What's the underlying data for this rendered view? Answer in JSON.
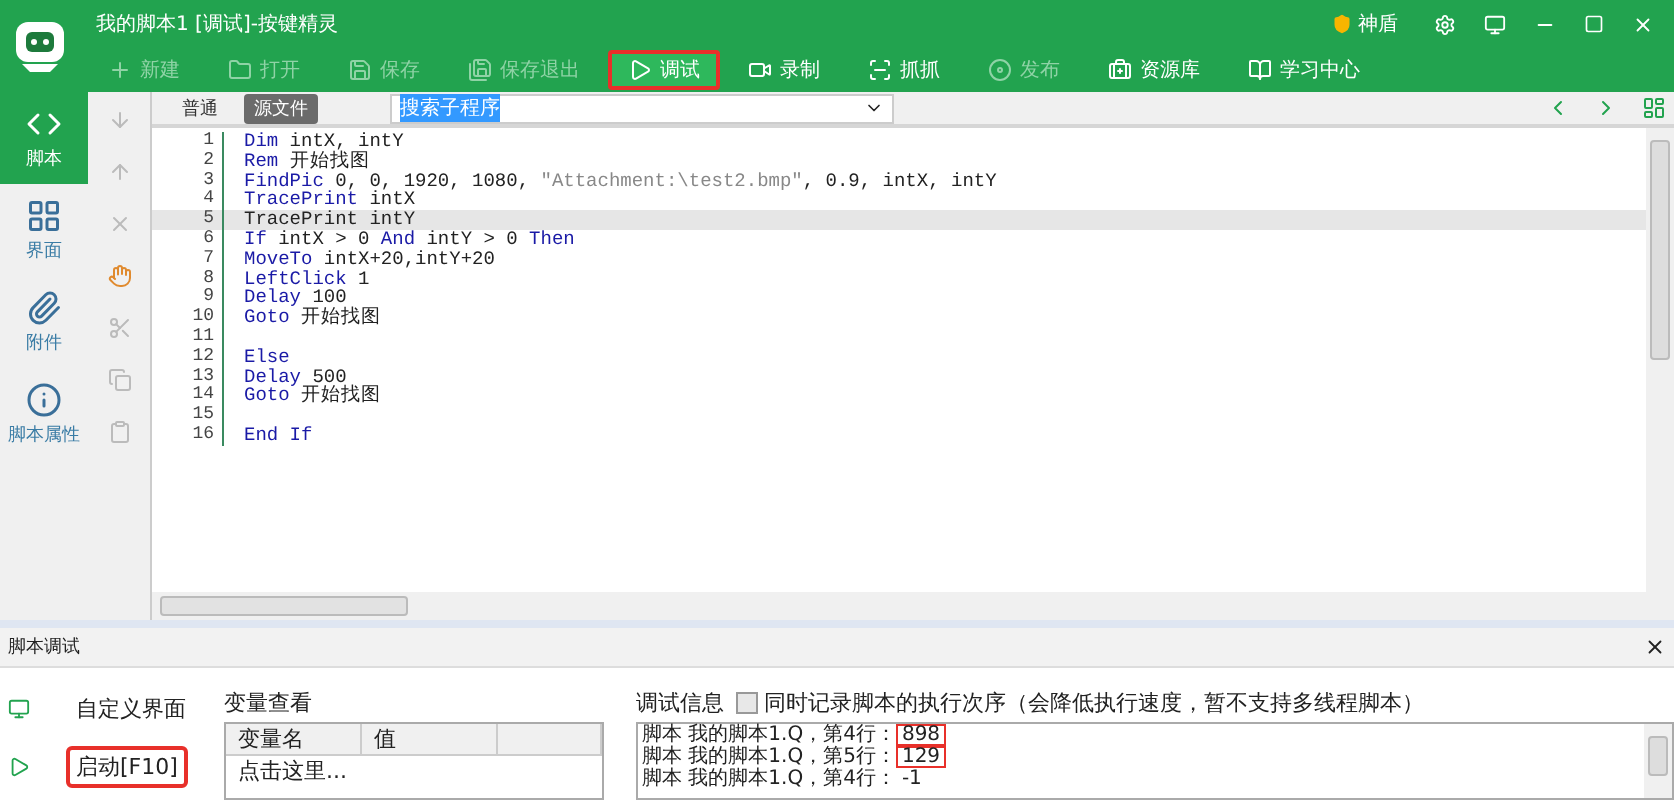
{
  "window": {
    "title": "我的脚本1 [调试]-按键精灵",
    "shield": "神盾"
  },
  "toolbar": [
    {
      "label": "新建",
      "disabled": true,
      "selected": false,
      "highlighted": false
    },
    {
      "label": "打开",
      "disabled": true,
      "selected": false,
      "highlighted": false
    },
    {
      "label": "保存",
      "disabled": true,
      "selected": false,
      "highlighted": false
    },
    {
      "label": "保存退出",
      "disabled": true,
      "selected": false,
      "highlighted": false
    },
    {
      "label": "调试",
      "disabled": false,
      "selected": true,
      "highlighted": true
    },
    {
      "label": "录制",
      "disabled": false,
      "selected": false,
      "highlighted": false
    },
    {
      "label": "抓抓",
      "disabled": false,
      "selected": false,
      "highlighted": false
    },
    {
      "label": "发布",
      "disabled": true,
      "selected": false,
      "highlighted": false
    },
    {
      "label": "资源库",
      "disabled": false,
      "selected": false,
      "highlighted": false
    },
    {
      "label": "学习中心",
      "disabled": false,
      "selected": false,
      "highlighted": false
    }
  ],
  "sidebar": {
    "items": [
      {
        "label": "脚本",
        "selected": true
      },
      {
        "label": "界面",
        "selected": false
      },
      {
        "label": "附件",
        "selected": false
      },
      {
        "label": "脚本属性",
        "selected": false
      }
    ]
  },
  "editor": {
    "tabs": [
      {
        "label": "普通",
        "selected": false
      },
      {
        "label": "源文件",
        "selected": true
      }
    ],
    "search": {
      "value": "搜索子程序"
    },
    "lines": [
      {
        "number": "1",
        "current": false,
        "tokens": [
          {
            "kind": "keyword",
            "text": "Dim"
          },
          {
            "kind": "plain",
            "text": " intX, intY"
          }
        ]
      },
      {
        "number": "2",
        "current": false,
        "tokens": [
          {
            "kind": "keyword",
            "text": "Rem"
          },
          {
            "kind": "plain",
            "text": " 开始找图"
          }
        ]
      },
      {
        "number": "3",
        "current": false,
        "tokens": [
          {
            "kind": "keyword",
            "text": "FindPic"
          },
          {
            "kind": "plain",
            "text": " 0, 0, 1920, 1080, "
          },
          {
            "kind": "string",
            "text": "\"Attachment:\\test2.bmp\""
          },
          {
            "kind": "plain",
            "text": ", 0.9, intX, intY"
          }
        ]
      },
      {
        "number": "4",
        "current": false,
        "tokens": [
          {
            "kind": "keyword",
            "text": "TracePrint"
          },
          {
            "kind": "plain",
            "text": " intX"
          }
        ]
      },
      {
        "number": "5",
        "current": true,
        "tokens": [
          {
            "kind": "plain",
            "text": "TracePrint intY"
          }
        ]
      },
      {
        "number": "6",
        "current": false,
        "tokens": [
          {
            "kind": "keyword",
            "text": "If"
          },
          {
            "kind": "plain",
            "text": " intX > 0 "
          },
          {
            "kind": "keyword",
            "text": "And"
          },
          {
            "kind": "plain",
            "text": " intY > 0 "
          },
          {
            "kind": "keyword",
            "text": "Then"
          }
        ]
      },
      {
        "number": "7",
        "current": false,
        "tokens": [
          {
            "kind": "keyword",
            "text": "MoveTo"
          },
          {
            "kind": "plain",
            "text": " intX+20,intY+20"
          }
        ]
      },
      {
        "number": "8",
        "current": false,
        "tokens": [
          {
            "kind": "keyword",
            "text": "LeftClick"
          },
          {
            "kind": "plain",
            "text": " 1"
          }
        ]
      },
      {
        "number": "9",
        "current": false,
        "tokens": [
          {
            "kind": "keyword",
            "text": "Delay"
          },
          {
            "kind": "plain",
            "text": " 100"
          }
        ]
      },
      {
        "number": "10",
        "current": false,
        "tokens": [
          {
            "kind": "keyword",
            "text": "Goto"
          },
          {
            "kind": "plain",
            "text": " 开始找图"
          }
        ]
      },
      {
        "number": "11",
        "current": false
      },
      {
        "number": "12",
        "current": false,
        "tokens": [
          {
            "kind": "keyword",
            "text": "Else"
          }
        ]
      },
      {
        "number": "13",
        "current": false,
        "tokens": [
          {
            "kind": "keyword",
            "text": "Delay"
          },
          {
            "kind": "plain",
            "text": " 500"
          }
        ]
      },
      {
        "number": "14",
        "current": false,
        "tokens": [
          {
            "kind": "keyword",
            "text": "Goto"
          },
          {
            "kind": "plain",
            "text": " 开始找图"
          }
        ]
      },
      {
        "number": "15",
        "current": false
      },
      {
        "number": "16",
        "current": false,
        "tokens": [
          {
            "kind": "keyword",
            "text": "End If"
          }
        ]
      }
    ]
  },
  "debug_panel": {
    "title": "脚本调试",
    "actions": [
      {
        "label": "自定义界面",
        "highlighted": false
      },
      {
        "label": "启动[F10]",
        "highlighted": true
      }
    ],
    "variables": {
      "title": "变量查看",
      "columns": [
        "变量名",
        "值"
      ],
      "rows": [
        [
          "点击这里..."
        ]
      ]
    },
    "log": {
      "title": "调试信息",
      "record_order": {
        "label": "同时记录脚本的执行次序（会降低执行速度，暂不支持多线程脚本）",
        "checked": false
      },
      "lines": [
        {
          "text": "脚本 我的脚本1.Q，第4行：",
          "value": "898",
          "highlighted": true
        },
        {
          "text": "脚本 我的脚本1.Q，第5行：",
          "value": "129",
          "highlighted": true
        },
        {
          "text": "脚本 我的脚本1.Q，第4行：",
          "value": "-1",
          "highlighted": false
        }
      ]
    }
  }
}
